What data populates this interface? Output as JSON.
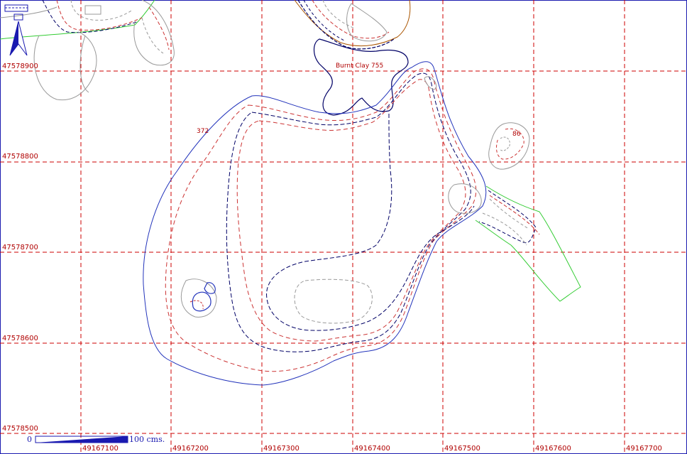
{
  "map": {
    "grid_x_labels": [
      "49167100",
      "49167200",
      "49167300",
      "49167400",
      "49167500",
      "49167600",
      "49167700"
    ],
    "grid_y_labels": [
      "47578900",
      "47578800",
      "47578700",
      "47578600",
      "47578500"
    ],
    "feature_labels": {
      "burnt_clay": "Burnt Clay 755",
      "feature_372": "372",
      "feature_86": "86"
    },
    "scale_bar": {
      "start_label": "0",
      "end_label": "100 cms."
    },
    "colors": {
      "grid": "#cc0000",
      "outline_blue": "#2233bb",
      "dash_navy": "#000066",
      "dash_red": "#cc3333",
      "dash_gray": "#999999",
      "green": "#33cc33",
      "brown": "#aa5500",
      "north_arrow": "#1a1ab0"
    },
    "icons": {
      "north_arrow": "north-arrow-icon"
    }
  }
}
